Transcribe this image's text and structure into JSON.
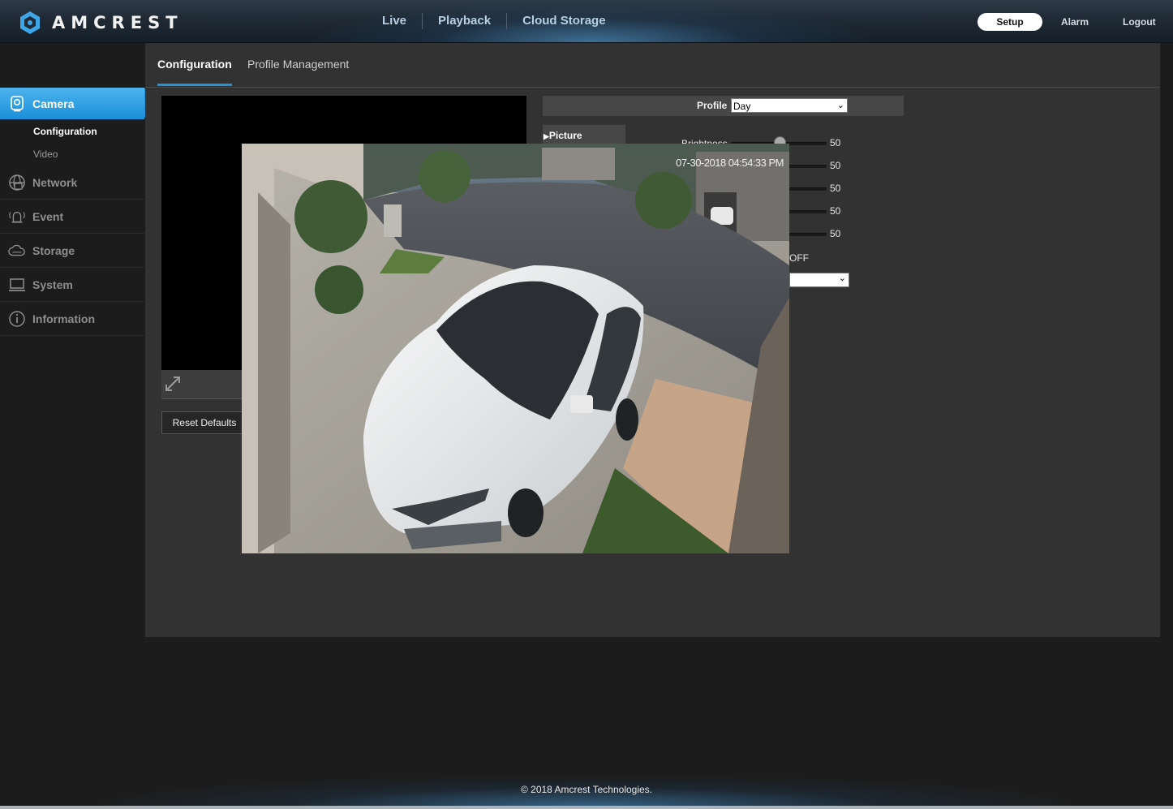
{
  "header": {
    "brand": "AMCREST",
    "nav": [
      "Live",
      "Playback",
      "Cloud Storage"
    ],
    "setup_label": "Setup",
    "alarm_label": "Alarm",
    "logout_label": "Logout"
  },
  "sidebar": {
    "items": [
      {
        "label": "Camera",
        "icon": "camera-icon",
        "active": true
      },
      {
        "label": "Network",
        "icon": "network-icon"
      },
      {
        "label": "Event",
        "icon": "event-icon"
      },
      {
        "label": "Storage",
        "icon": "storage-icon"
      },
      {
        "label": "System",
        "icon": "system-icon"
      },
      {
        "label": "Information",
        "icon": "information-icon"
      }
    ],
    "camera_sub": [
      "Configuration",
      "Video"
    ]
  },
  "tabs": [
    "Configuration",
    "Profile Management"
  ],
  "profile": {
    "label": "Profile",
    "value": "Day"
  },
  "picture_tab": "Picture",
  "brightness_label": "Brightness",
  "slider_values": [
    "50",
    "50",
    "50",
    "50",
    "50"
  ],
  "off_text": "OFF",
  "reset_label": "Reset Defaults",
  "camera_feed": {
    "timestamp": "07-30-2018 04:54:33 PM"
  },
  "footer": "© 2018 Amcrest Technologies.",
  "colors": {
    "accent": "#1f94dc",
    "panel": "#323232",
    "background": "#1c1c1c"
  }
}
